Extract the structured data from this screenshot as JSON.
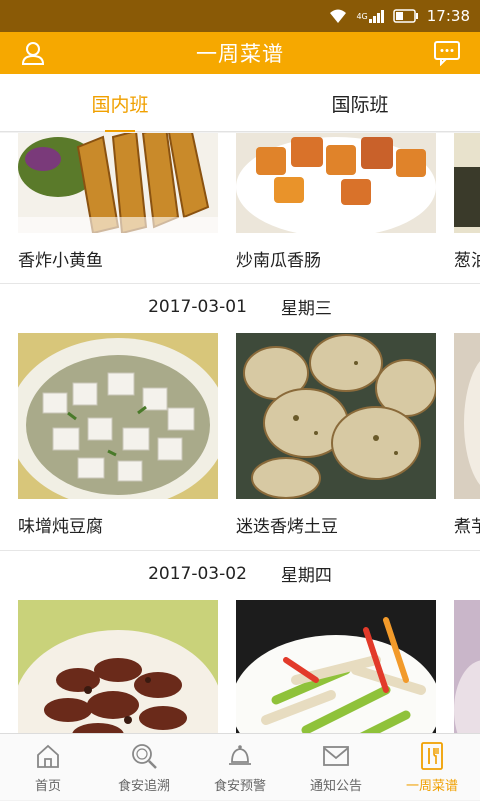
{
  "status_bar": {
    "time": "17:38",
    "network": "4G"
  },
  "header": {
    "title": "一周菜谱",
    "left_icon": "user-icon",
    "right_icon": "message-icon"
  },
  "tabs": [
    {
      "label": "国内班",
      "active": true
    },
    {
      "label": "国际班",
      "active": false
    }
  ],
  "days": [
    {
      "date": "",
      "weekday": "",
      "dishes": [
        {
          "name": "香炸小黄鱼",
          "image": "fried-fish"
        },
        {
          "name": "炒南瓜香肠",
          "image": "pumpkin-sausage"
        },
        {
          "name": "葱油",
          "image": "partial-dish"
        }
      ]
    },
    {
      "date": "2017-03-01",
      "weekday": "星期三",
      "dishes": [
        {
          "name": "味增炖豆腐",
          "image": "miso-tofu"
        },
        {
          "name": "迷迭香烤土豆",
          "image": "roast-potato"
        },
        {
          "name": "煮芋",
          "image": "partial-dish"
        }
      ]
    },
    {
      "date": "2017-03-02",
      "weekday": "星期四",
      "dishes": [
        {
          "name": "",
          "image": "braised-eggplant"
        },
        {
          "name": "",
          "image": "celery-tofu"
        },
        {
          "name": "",
          "image": "partial-dish"
        }
      ]
    }
  ],
  "bottom_nav": [
    {
      "label": "首页",
      "icon": "home-icon",
      "active": false
    },
    {
      "label": "食安追溯",
      "icon": "search-icon",
      "active": false
    },
    {
      "label": "食安预警",
      "icon": "bell-icon",
      "active": false
    },
    {
      "label": "通知公告",
      "icon": "mail-icon",
      "active": false
    },
    {
      "label": "一周菜谱",
      "icon": "menu-fork-icon",
      "active": true
    }
  ],
  "colors": {
    "accent": "#f6a800",
    "status_bar": "#8a5a06",
    "active_text": "#f0a000"
  }
}
